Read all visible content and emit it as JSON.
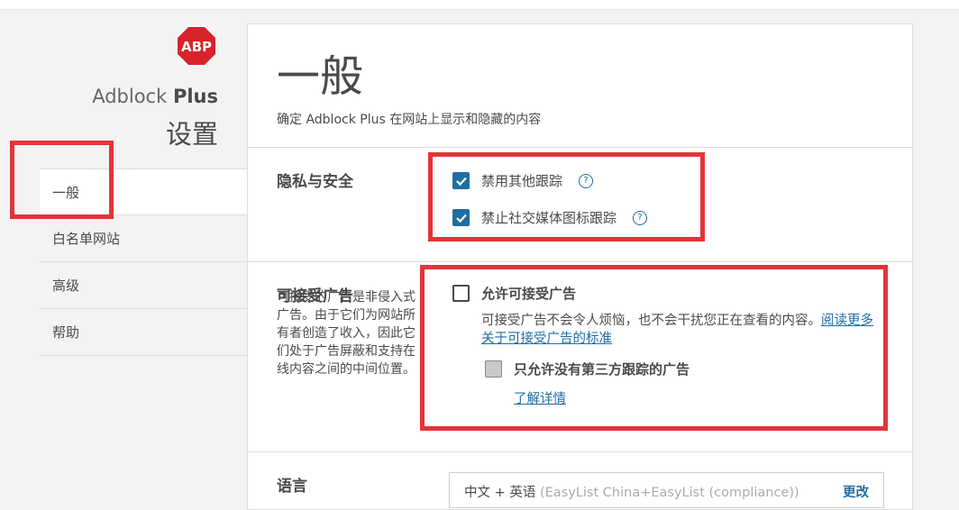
{
  "brand": {
    "name": "Adblock ",
    "name_bold": "Plus",
    "settings_title": "设置",
    "logo_text": "ABP",
    "logo_color": "#d8232a"
  },
  "nav": {
    "items": [
      {
        "label": "一般",
        "active": true
      },
      {
        "label": "白名单网站"
      },
      {
        "label": "高级"
      },
      {
        "label": "帮助"
      }
    ]
  },
  "main": {
    "title": "一般",
    "description": "确定 Adblock Plus 在网站上显示和隐藏的内容",
    "privacy": {
      "title": "隐私与安全",
      "options": [
        {
          "label": "禁用其他跟踪",
          "checked": true,
          "help": "?"
        },
        {
          "label": "禁止社交媒体图标跟踪",
          "checked": true,
          "help": "?"
        }
      ]
    },
    "acceptable_ads": {
      "title": "可接受广告",
      "description": "可接受的广告是非侵入式广告。由于它们为网站所有者创造了收入，因此它们处于广告屏蔽和支持在线内容之间的中间位置。",
      "allow_label": "允许可接受广告",
      "allow_checked": false,
      "allow_desc": "可接受广告不会令人烦恼，也不会干扰您正在查看的内容。",
      "read_more_link": "阅读更多关于可接受广告的标准",
      "no_tracking_label": "只允许没有第三方跟踪的广告",
      "learn_more_link": "了解详情"
    },
    "language": {
      "title": "语言",
      "current": "中文 + 英语",
      "lists": "(EasyList China+EasyList (compliance))",
      "change_label": "更改"
    }
  },
  "colors": {
    "accent": "#1f6ea3",
    "highlight": "#e5333a"
  }
}
